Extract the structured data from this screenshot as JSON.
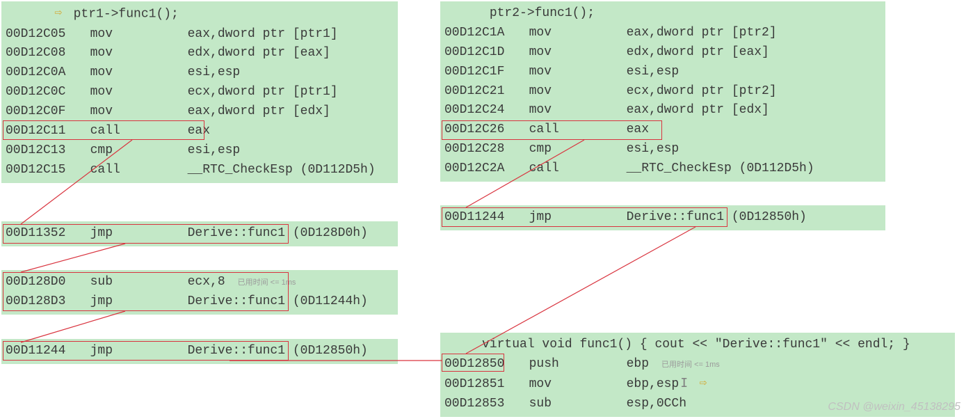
{
  "left": {
    "header": {
      "indent": "      ",
      "arrow_glyph": "⇨",
      "source": "ptr1->func1();"
    },
    "rows": [
      {
        "addr": "00D12C05",
        "mnem": "mov",
        "op": "eax,dword ptr [ptr1]"
      },
      {
        "addr": "00D12C08",
        "mnem": "mov",
        "op": "edx,dword ptr [eax]"
      },
      {
        "addr": "00D12C0A",
        "mnem": "mov",
        "op": "esi,esp"
      },
      {
        "addr": "00D12C0C",
        "mnem": "mov",
        "op": "ecx,dword ptr [ptr1]"
      },
      {
        "addr": "00D12C0F",
        "mnem": "mov",
        "op": "eax,dword ptr [edx]"
      },
      {
        "addr": "00D12C11",
        "mnem": "call",
        "op": "eax"
      },
      {
        "addr": "00D12C13",
        "mnem": "cmp",
        "op": "esi,esp"
      },
      {
        "addr": "00D12C15",
        "mnem": "call",
        "op": "__RTC_CheckEsp (0D112D5h)"
      }
    ],
    "jmp1": {
      "addr": "00D11352",
      "mnem": "jmp",
      "op": "Derive::func1 (0D128D0h)"
    },
    "jmp2a": {
      "addr": "00D128D0",
      "mnem": "sub",
      "op": "ecx,8",
      "hint": "已用时间 <= 1ms"
    },
    "jmp2b": {
      "addr": "00D128D3",
      "mnem": "jmp",
      "op": "Derive::func1 (0D11244h)"
    },
    "jmp3": {
      "addr": "00D11244",
      "mnem": "jmp",
      "op": "Derive::func1 (0D12850h)"
    }
  },
  "right": {
    "header": {
      "indent": "      ",
      "source": "ptr2->func1();"
    },
    "rows": [
      {
        "addr": "00D12C1A",
        "mnem": "mov",
        "op": "eax,dword ptr [ptr2]"
      },
      {
        "addr": "00D12C1D",
        "mnem": "mov",
        "op": "edx,dword ptr [eax]"
      },
      {
        "addr": "00D12C1F",
        "mnem": "mov",
        "op": "esi,esp"
      },
      {
        "addr": "00D12C21",
        "mnem": "mov",
        "op": "ecx,dword ptr [ptr2]"
      },
      {
        "addr": "00D12C24",
        "mnem": "mov",
        "op": "eax,dword ptr [edx]"
      },
      {
        "addr": "00D12C26",
        "mnem": "call",
        "op": "eax"
      },
      {
        "addr": "00D12C28",
        "mnem": "cmp",
        "op": "esi,esp"
      },
      {
        "addr": "00D12C2A",
        "mnem": "call",
        "op": "__RTC_CheckEsp (0D112D5h)"
      }
    ],
    "jmp1": {
      "addr": "00D11244",
      "mnem": "jmp",
      "op": "Derive::func1 (0D12850h)"
    },
    "func": {
      "indent": "     ",
      "source": "virtual void func1() { cout << \"Derive::func1\" << endl; }",
      "rows": [
        {
          "addr": "00D12850",
          "mnem": "push",
          "op": "ebp",
          "hint": "已用时间 <= 1ms"
        },
        {
          "addr": "00D12851",
          "mnem": "mov",
          "op": "ebp,esp",
          "arrow_glyph": "⇨"
        },
        {
          "addr": "00D12853",
          "mnem": "sub",
          "op": "esp,0CCh"
        }
      ]
    }
  },
  "watermark": "CSDN @weixin_45138295"
}
